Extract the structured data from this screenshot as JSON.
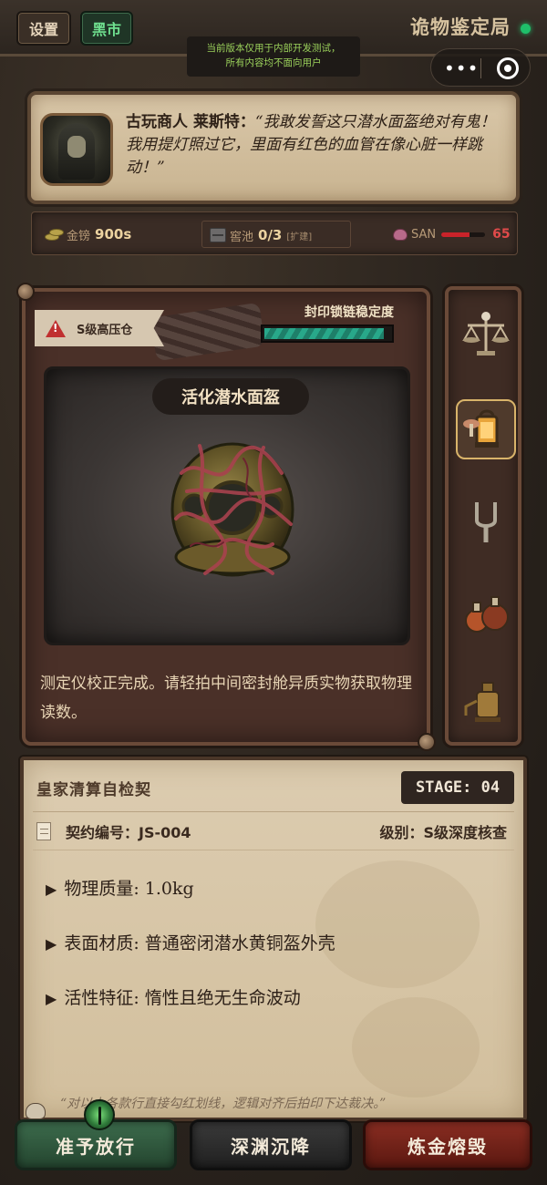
{
  "topbar": {
    "settings_label": "设置",
    "market_label": "黑市",
    "app_title": "诡物鉴定局",
    "notice_line1": "当前版本仅用于内部开发测试，",
    "notice_line2": "所有内容均不面向用户"
  },
  "merchant": {
    "name": "古玩商人 莱斯特：",
    "quote": "“我敢发誓这只潜水面盔绝对有鬼！我用提灯照过它，里面有红色的血管在像心脏一样跳动！”",
    "avatar_icon": "hooded-merchant-portrait"
  },
  "stats": {
    "gold_label": "金镑",
    "gold_value": "900s",
    "pool_label": "窖池",
    "pool_value": "0/3",
    "pool_expand": "[扩建]",
    "san_label": "SAN",
    "san_value": "65",
    "san_fraction": 0.65
  },
  "containment": {
    "tier_tag": "S级高压仓",
    "seal_label": "封印锁链稳定度",
    "seal_fraction": 0.95,
    "item_name": "活化潜水面盔",
    "description": "测定仪校正完成。请轻拍中间密封舱异质实物获取物理读数。"
  },
  "tools": [
    {
      "icon": "scales-icon"
    },
    {
      "icon": "lantern-icon"
    },
    {
      "icon": "tuning-fork-icon"
    },
    {
      "icon": "potions-icon"
    },
    {
      "icon": "distiller-icon"
    }
  ],
  "contract": {
    "title": "皇家清算自检契",
    "stage": "STAGE: 04",
    "id_text": "契约编号：JS-004",
    "level_text": "级别：S级深度核查",
    "attrs": [
      "物理质量: 1.0kg",
      "表面材质: 普通密闭潜水黄铜盔外壳",
      "活性特征: 惰性且绝无生命波动"
    ],
    "footer": "“对以上各款行直接勾红划线，逻辑对齐后拍印下达裁决。”"
  },
  "actions": {
    "pass": "准予放行",
    "abyss": "深渊沉降",
    "melt": "炼金熔毁"
  },
  "colors": {
    "pass_green": "#2f5a3e",
    "abyss_gray": "#2a2a2a",
    "melt_red": "#7a2418",
    "san_red": "#c9232a",
    "seal_teal": "#28a88a"
  }
}
